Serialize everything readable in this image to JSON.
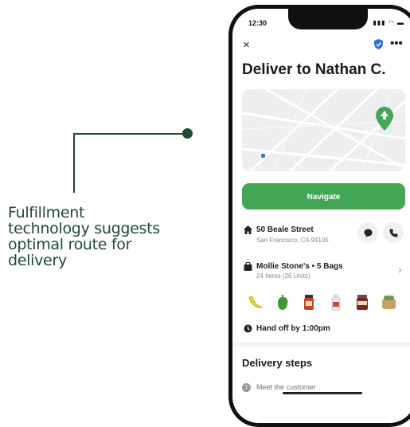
{
  "callout": {
    "text": "Fulfillment technology suggests optimal route for delivery"
  },
  "status_bar": {
    "time": "12:30",
    "icons": "▮▮▮ ◠ ▬"
  },
  "header": {
    "close_label": "×",
    "more_label": "•••",
    "title": "Deliver to Nathan C."
  },
  "navigate_label": "Navigate",
  "address": {
    "street": "50 Beale Street",
    "city": "San Francisco, CA 94105"
  },
  "order": {
    "store": "Mollie Stone's • 5 Bags",
    "items": "24 Items (26 Units)"
  },
  "handoff": "Hand off by 1:00pm",
  "delivery_steps": {
    "title": "Delivery steps",
    "steps": [
      {
        "num": "1",
        "label": "Meet the customer"
      }
    ]
  },
  "icons": [
    "close-icon",
    "shield-icon",
    "more-icon",
    "home-icon",
    "chat-icon",
    "phone-icon",
    "bag-icon",
    "chevron-right-icon",
    "clock-icon"
  ],
  "colors": {
    "brand_green": "#43a655",
    "callout_green": "#1f4a33"
  }
}
